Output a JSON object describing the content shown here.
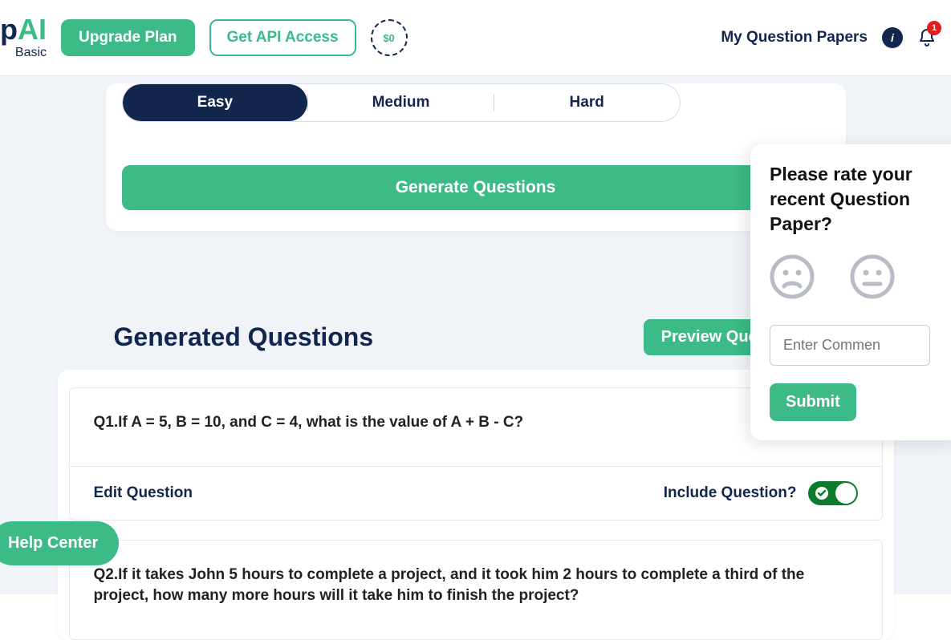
{
  "header": {
    "logo_ep": "ep",
    "logo_ai": "AI",
    "logo_sub": "Basic",
    "upgrade_label": "Upgrade Plan",
    "api_label": "Get API Access",
    "credits": "$0",
    "my_papers_label": "My Question Papers",
    "notification_count": "1"
  },
  "difficulty": {
    "easy": "Easy",
    "medium": "Medium",
    "hard": "Hard",
    "active": "easy"
  },
  "generate_label": "Generate Questions",
  "generated": {
    "title": "Generated Questions",
    "preview_label": "Preview Question Pa",
    "edit_label": "Edit Question",
    "include_label": "Include Question?",
    "questions": [
      {
        "text": "Q1.If A = 5, B = 10, and C = 4, what is the value of A + B - C?"
      },
      {
        "text": "Q2.If it takes John 5 hours to complete a project, and it took him 2 hours to complete a third of the project, how many more hours will it take him to finish the project?"
      }
    ]
  },
  "help_label": "Help Center",
  "rate_panel": {
    "title": "Please rate your recent Question Paper?",
    "comment_placeholder": "Enter Commen",
    "submit_label": "Submit"
  }
}
